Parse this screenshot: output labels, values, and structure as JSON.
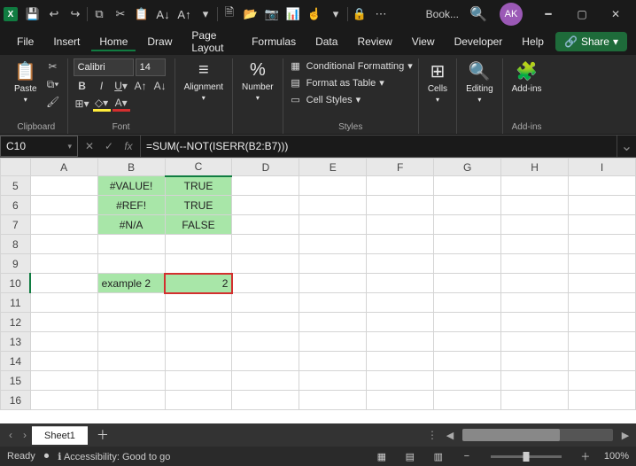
{
  "title_bar": {
    "doc_name": "Book...",
    "avatar": "AK"
  },
  "menu": {
    "file": "File",
    "insert": "Insert",
    "home": "Home",
    "draw": "Draw",
    "page_layout": "Page Layout",
    "formulas": "Formulas",
    "data": "Data",
    "review": "Review",
    "view": "View",
    "developer": "Developer",
    "help": "Help",
    "share": "Share"
  },
  "ribbon": {
    "paste": "Paste",
    "clipboard": "Clipboard",
    "font_name": "Calibri",
    "font_size": "14",
    "font_group": "Font",
    "alignment": "Alignment",
    "number": "Number",
    "cond_fmt": "Conditional Formatting",
    "as_table": "Format as Table",
    "cell_styles": "Cell Styles",
    "styles": "Styles",
    "cells": "Cells",
    "editing": "Editing",
    "addins": "Add-ins"
  },
  "formula_bar": {
    "name_box": "C10",
    "formula": "=SUM(--NOT(ISERR(B2:B7)))"
  },
  "columns": [
    "A",
    "B",
    "C",
    "D",
    "E",
    "F",
    "G",
    "H",
    "I"
  ],
  "rows": [
    {
      "n": "5",
      "b": "#VALUE!",
      "c": "TRUE"
    },
    {
      "n": "6",
      "b": "#REF!",
      "c": "TRUE"
    },
    {
      "n": "7",
      "b": "#N/A",
      "c": "FALSE"
    },
    {
      "n": "8"
    },
    {
      "n": "9"
    },
    {
      "n": "10",
      "b": "example 2",
      "c": "2",
      "sel": true
    },
    {
      "n": "11"
    },
    {
      "n": "12"
    },
    {
      "n": "13"
    },
    {
      "n": "14"
    },
    {
      "n": "15"
    },
    {
      "n": "16"
    }
  ],
  "tabs": {
    "sheet1": "Sheet1"
  },
  "status": {
    "ready": "Ready",
    "accessibility": "Accessibility: Good to go",
    "zoom": "100%"
  }
}
